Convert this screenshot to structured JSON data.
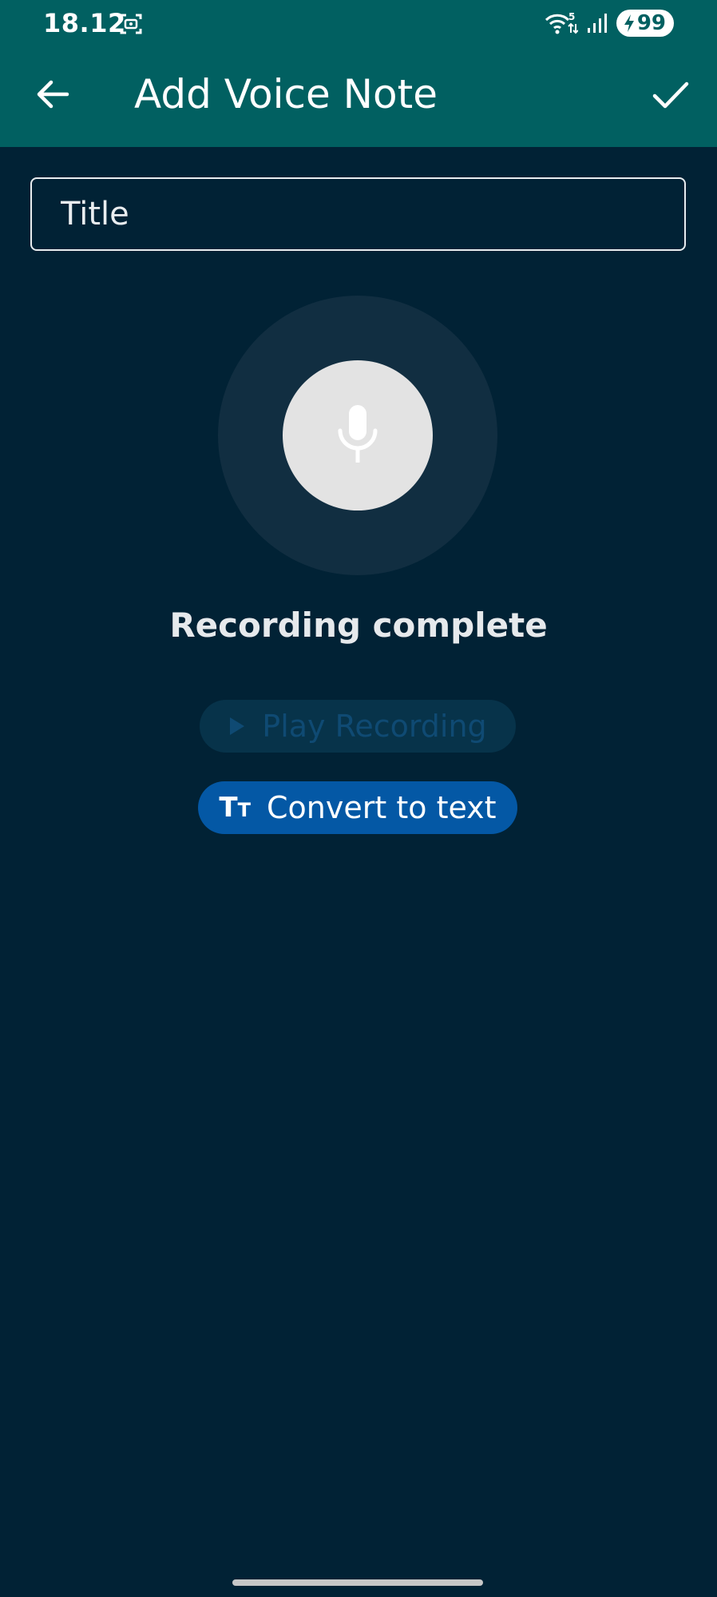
{
  "status_bar": {
    "time": "18.12",
    "battery_level": "99",
    "network_badge": "5",
    "icons": [
      "screenshot-icon",
      "wifi-icon",
      "signal-icon",
      "battery-charging-icon"
    ]
  },
  "header": {
    "title": "Add Voice Note",
    "back_icon": "arrow-left-icon",
    "confirm_icon": "check-icon"
  },
  "form": {
    "title_placeholder": "Title",
    "title_value": ""
  },
  "recorder": {
    "icon": "microphone-icon",
    "status_text": "Recording complete"
  },
  "actions": {
    "play_label": "Play Recording",
    "play_icon": "play-icon",
    "play_enabled": false,
    "convert_label": "Convert to text",
    "convert_icon": "text-size-icon"
  },
  "colors": {
    "app_bar": "#016061",
    "background": "#012235",
    "primary_button": "#0458a5",
    "disabled_button": "#07334a",
    "mic_button": "#e3e3e3",
    "mic_halo": "#112e41"
  }
}
